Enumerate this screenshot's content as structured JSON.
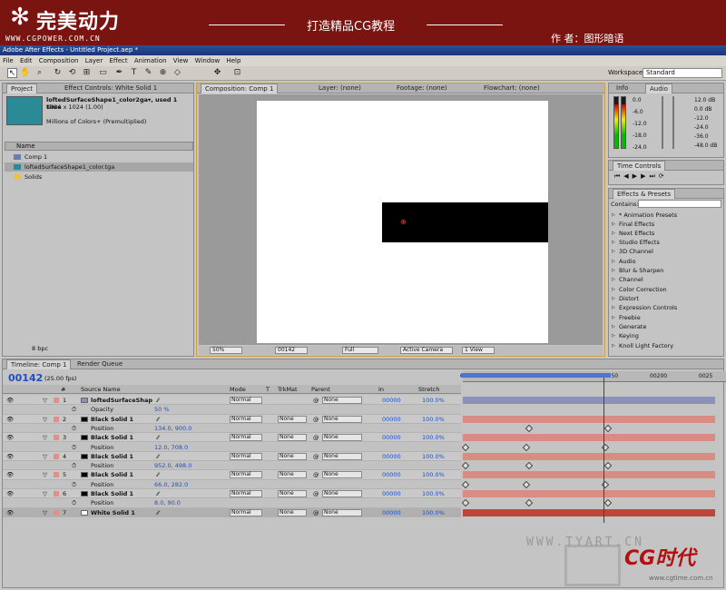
{
  "banner": {
    "logo_text": "完美动力",
    "logo_url": "WWW.CGPOWER.COM.CN",
    "slogan": "打造精品CG教程",
    "author": "作 者：图形暗语"
  },
  "window": {
    "title": "Adobe After Effects - Untitled Project.aep *"
  },
  "menu": [
    "File",
    "Edit",
    "Composition",
    "Layer",
    "Effect",
    "Animation",
    "View",
    "Window",
    "Help"
  ],
  "toolbar": {
    "workspace_label": "Workspace:",
    "workspace_value": "Standard"
  },
  "project_panel": {
    "tab_project": "Project",
    "tab_effect_controls": "Effect Controls: White Solid 1",
    "item_name": "loftedSurfaceShape1_color2ga▾, used 1 time",
    "item_dims": "1024 x 1024 (1.00)",
    "item_colors": "Millions of Colors+ (Premultiplied)",
    "col_name": "Name",
    "items": [
      "Comp 1",
      "loftedSurfaceShape1_color.tga",
      "Solids"
    ],
    "bpc": "8 bpc"
  },
  "viewer": {
    "tab_comp": "Composition: Comp 1",
    "tab_layer": "Layer: (none)",
    "tab_footage": "Footage: (none)",
    "tab_flowchart": "Flowchart: (none)",
    "zoom": "50%",
    "timecode": "00142",
    "resolution": "Full",
    "camera": "Active Camera",
    "view": "1 View"
  },
  "info_panel": {
    "tab_info": "Info",
    "tab_audio": "Audio",
    "left_db": [
      "0.0",
      "-6.0",
      "-12.0",
      "-18.0",
      "-24.0"
    ],
    "right_db": [
      "12.0 dB",
      "0.0 dB",
      "-12.0",
      "-24.0",
      "-36.0",
      "-48.0 dB"
    ]
  },
  "time_controls": {
    "tab": "Time Controls"
  },
  "effects_panel": {
    "tab": "Effects & Presets",
    "contains_label": "Contains:",
    "items": [
      "* Animation Presets",
      "Audio",
      "Blur & Sharpen",
      "Channel",
      "Color Correction",
      "Distort",
      "Expression Controls",
      "Freebie",
      "Generate",
      "Keying",
      "Knoll Light Factory"
    ],
    "items_top": [
      "Final Effects",
      "Next Effects",
      "Studio Effects",
      "3D Channel"
    ]
  },
  "timeline": {
    "tab_timeline": "Timeline: Comp 1",
    "tab_render": "Render Queue",
    "timecode": "00142",
    "fps": "(25.00 fps)",
    "columns": {
      "num": "#",
      "source": "Source Name",
      "mode": "Mode",
      "t": "T",
      "trkmat": "TrkMat",
      "parent": "Parent",
      "in": "In",
      "stretch": "Stretch"
    },
    "ruler_ticks": [
      "00000",
      "00050",
      "00100",
      "00150",
      "00200",
      "0025"
    ],
    "work_area_end_fraction": 0.59,
    "playhead_frame": 142,
    "rows": [
      {
        "num": "1",
        "name": "loftedSurfaceShap",
        "type": "layer",
        "color": "#8a8fc0",
        "mode": "Normal",
        "trkmat": "",
        "parent": "None",
        "in": "00000",
        "stretch": "100.0%",
        "bar": "purple",
        "keyframes": []
      },
      {
        "num": "",
        "name": "Opacity",
        "type": "prop",
        "value": "50 %",
        "bar": "none",
        "keyframes": []
      },
      {
        "num": "2",
        "name": "Black Solid 1",
        "type": "layer",
        "color": "#000000",
        "mode": "Normal",
        "trkmat": "None",
        "parent": "None",
        "in": "00000",
        "stretch": "100.0%",
        "bar": "red",
        "keyframes": []
      },
      {
        "num": "",
        "name": "Position",
        "type": "prop",
        "value": "134.0, 900.0",
        "bar": "none",
        "keyframes": [
          25,
          56
        ]
      },
      {
        "num": "3",
        "name": "Black Solid 1",
        "type": "layer",
        "color": "#000000",
        "mode": "Normal",
        "trkmat": "None",
        "parent": "None",
        "in": "00000",
        "stretch": "100.0%",
        "bar": "red",
        "keyframes": []
      },
      {
        "num": "",
        "name": "Position",
        "type": "prop",
        "value": "12.0, 708.0",
        "bar": "none",
        "keyframes": [
          0,
          24,
          55
        ]
      },
      {
        "num": "4",
        "name": "Black Solid 1",
        "type": "layer",
        "color": "#000000",
        "mode": "Normal",
        "trkmat": "None",
        "parent": "None",
        "in": "00000",
        "stretch": "100.0%",
        "bar": "red",
        "keyframes": []
      },
      {
        "num": "",
        "name": "Position",
        "type": "prop",
        "value": "952.0, 498.0",
        "bar": "none",
        "keyframes": [
          0,
          25,
          56
        ]
      },
      {
        "num": "5",
        "name": "Black Solid 1",
        "type": "layer",
        "color": "#000000",
        "mode": "Normal",
        "trkmat": "None",
        "parent": "None",
        "in": "00000",
        "stretch": "100.0%",
        "bar": "red",
        "keyframes": []
      },
      {
        "num": "",
        "name": "Position",
        "type": "prop",
        "value": "66.0, 282.0",
        "bar": "none",
        "keyframes": [
          0,
          24,
          55
        ]
      },
      {
        "num": "6",
        "name": "Black Solid 1",
        "type": "layer",
        "color": "#000000",
        "mode": "Normal",
        "trkmat": "None",
        "parent": "None",
        "in": "00000",
        "stretch": "100.0%",
        "bar": "red",
        "keyframes": []
      },
      {
        "num": "",
        "name": "Position",
        "type": "prop",
        "value": "8.0, 90.0",
        "bar": "none",
        "keyframes": [
          0,
          25,
          56
        ]
      },
      {
        "num": "7",
        "name": "White Solid 1",
        "type": "layer",
        "color": "#ffffff",
        "mode": "Normal",
        "trkmat": "None",
        "parent": "None",
        "in": "00000",
        "stretch": "100.0%",
        "bar": "dark",
        "keyframes": [],
        "selected": true
      }
    ]
  },
  "watermark": {
    "url": "WWW.TYART.CN",
    "logo": "CG时代",
    "site": "www.cgtime.com.cn"
  }
}
